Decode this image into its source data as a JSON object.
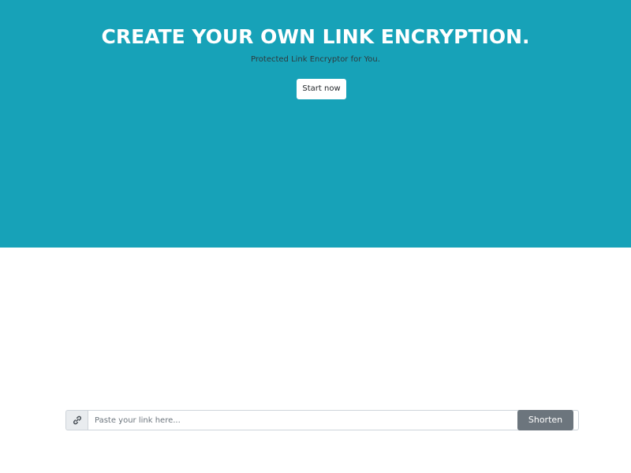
{
  "colors": {
    "hero_background": "#17a2b8",
    "shorten_button": "#6c757d"
  },
  "hero": {
    "title": "CREATE YOUR OWN LINK ENCRYPTION.",
    "subtitle": "Protected Link Encryptor for You.",
    "cta_label": "Start now"
  },
  "shortener": {
    "icon": "link-icon",
    "input_value": "",
    "input_placeholder": "Paste your link here...",
    "button_label": "Shorten"
  }
}
